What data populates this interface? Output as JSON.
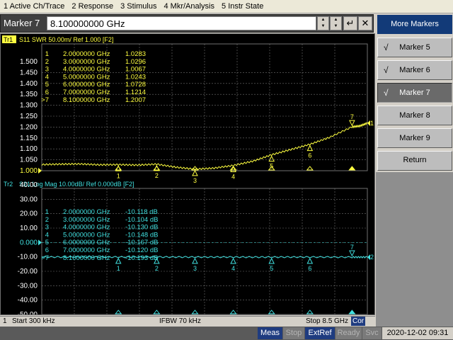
{
  "menu": [
    "1 Active Ch/Trace",
    "2 Response",
    "3 Stimulus",
    "4 Mkr/Analysis",
    "5 Instr State"
  ],
  "entry": {
    "label": "Marker 7",
    "value": "8.100000000 GHz",
    "spin_up": "▲",
    "spin_down": "▼",
    "enter_glyph": "↵",
    "close_glyph": "✕"
  },
  "softkeys": {
    "title": "More Markers",
    "items": [
      {
        "label": "Marker 5",
        "checked": true,
        "active": false
      },
      {
        "label": "Marker 6",
        "checked": true,
        "active": false
      },
      {
        "label": "Marker 7",
        "checked": true,
        "active": true
      },
      {
        "label": "Marker 8",
        "checked": false,
        "active": false
      },
      {
        "label": "Marker 9",
        "checked": false,
        "active": false
      }
    ],
    "return_label": "Return",
    "check_glyph": "√"
  },
  "colors": {
    "trace1": "#ffff40",
    "trace2": "#40e0e0",
    "grid": "#707070",
    "background": "#000000"
  },
  "trace1": {
    "badge": "Tr1",
    "header": "S11  SWR 50.00m/ Ref 1.000 [F2]",
    "scale_labels": [
      "1.500",
      "1.450",
      "1.400",
      "1.350",
      "1.300",
      "1.250",
      "1.200",
      "1.150",
      "1.100",
      "1.050",
      "1.000"
    ],
    "ref_value_label": "1.000",
    "y_min": 1.0,
    "y_max": 1.5,
    "table": [
      {
        "id": "1",
        "freq": "2.0000000 GHz",
        "val": "1.0283"
      },
      {
        "id": "2",
        "freq": "3.0000000 GHz",
        "val": "1.0296"
      },
      {
        "id": "3",
        "freq": "4.0000000 GHz",
        "val": "1.0067"
      },
      {
        "id": "4",
        "freq": "5.0000000 GHz",
        "val": "1.0243"
      },
      {
        "id": "5",
        "freq": "6.0000000 GHz",
        "val": "1.0728"
      },
      {
        "id": "6",
        "freq": "7.0000000 GHz",
        "val": "1.1214"
      },
      {
        "id": ">7",
        "freq": "8.1000000 GHz",
        "val": "1.2007"
      }
    ],
    "points": [
      [
        0.0003,
        1.028
      ],
      [
        0.5,
        1.03
      ],
      [
        1.0,
        1.031
      ],
      [
        1.5,
        1.027
      ],
      [
        2.0,
        1.028
      ],
      [
        2.5,
        1.026
      ],
      [
        3.0,
        1.03
      ],
      [
        3.5,
        1.016
      ],
      [
        4.0,
        1.007
      ],
      [
        4.5,
        1.012
      ],
      [
        5.0,
        1.024
      ],
      [
        5.5,
        1.043
      ],
      [
        6.0,
        1.073
      ],
      [
        6.5,
        1.097
      ],
      [
        7.0,
        1.121
      ],
      [
        7.5,
        1.152
      ],
      [
        8.1,
        1.201
      ],
      [
        8.3,
        1.205
      ],
      [
        8.5,
        1.218
      ]
    ]
  },
  "trace2": {
    "badge": "Tr2",
    "header": "S21  Log Mag 10.00dB/ Ref 0.000dB [F2]",
    "scale_labels": [
      "40.00",
      "30.00",
      "20.00",
      "10.00",
      "0.000",
      "-10.00",
      "-20.00",
      "-30.00",
      "-40.00",
      "-50.00"
    ],
    "ref_value_label": "0.000",
    "y_min": -50,
    "y_max": 40,
    "table": [
      {
        "id": "1",
        "freq": "2.0000000 GHz",
        "val": "-10.118 dB"
      },
      {
        "id": "2",
        "freq": "3.0000000 GHz",
        "val": "-10.104 dB"
      },
      {
        "id": "3",
        "freq": "4.0000000 GHz",
        "val": "-10.130 dB"
      },
      {
        "id": "4",
        "freq": "5.0000000 GHz",
        "val": "-10.148 dB"
      },
      {
        "id": "5",
        "freq": "6.0000000 GHz",
        "val": "-10.167 dB"
      },
      {
        "id": "6",
        "freq": "7.0000000 GHz",
        "val": "-10.120 dB"
      },
      {
        "id": ">7",
        "freq": "8.1000000 GHz",
        "val": "-10.193 dB"
      }
    ],
    "points": [
      [
        0.0003,
        -10.1
      ],
      [
        1.0,
        -10.11
      ],
      [
        2.0,
        -10.12
      ],
      [
        3.0,
        -10.1
      ],
      [
        4.0,
        -10.13
      ],
      [
        5.0,
        -10.15
      ],
      [
        6.0,
        -10.17
      ],
      [
        7.0,
        -10.12
      ],
      [
        8.1,
        -10.19
      ],
      [
        8.5,
        -10.2
      ]
    ]
  },
  "markers": [
    {
      "id": "1",
      "freq": 2.0
    },
    {
      "id": "2",
      "freq": 3.0
    },
    {
      "id": "3",
      "freq": 4.0
    },
    {
      "id": "4",
      "freq": 5.0
    },
    {
      "id": "5",
      "freq": 6.0
    },
    {
      "id": "6",
      "freq": 7.0
    },
    {
      "id": "7",
      "freq": 8.1
    }
  ],
  "x_range": [
    0.0003,
    8.5
  ],
  "statusbar": {
    "channel": "1",
    "start": "Start 300 kHz",
    "ifbw": "IFBW 70 kHz",
    "stop": "Stop 8.5 GHz",
    "cor": "Cor"
  },
  "bottombar": {
    "meas": "Meas",
    "stop": "Stop",
    "extref": "ExtRef",
    "ready": "Ready",
    "svc": "Svc",
    "datetime": "2020-12-02 09:31"
  }
}
